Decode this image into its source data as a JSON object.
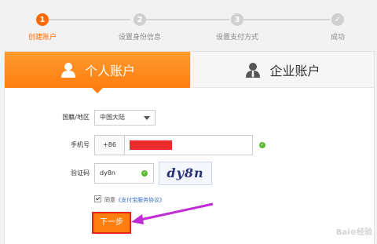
{
  "steps": [
    {
      "num": "1",
      "label": "创建账户",
      "state": "active"
    },
    {
      "num": "2",
      "label": "设置身份信息",
      "state": "pending"
    },
    {
      "num": "3",
      "label": "设置支付方式",
      "state": "pending"
    },
    {
      "num": "✓",
      "label": "成功",
      "state": "pending"
    }
  ],
  "tabs": {
    "personal": "个人账户",
    "business": "企业账户"
  },
  "form": {
    "region_label": "国籍/地区",
    "region_value": "中国大陆",
    "phone_label": "手机号",
    "phone_prefix": "+86",
    "captcha_label": "验证码",
    "captcha_value": "dy8n",
    "captcha_image_text": "dy8n",
    "agree_text": "同意",
    "agree_link": "《支付宝服务协议》",
    "next_button": "下一步"
  },
  "colors": {
    "accent": "#ff6a00",
    "annotation": "#c12bd6",
    "success": "#5cb930",
    "redaction": "#ee2b2b"
  }
}
